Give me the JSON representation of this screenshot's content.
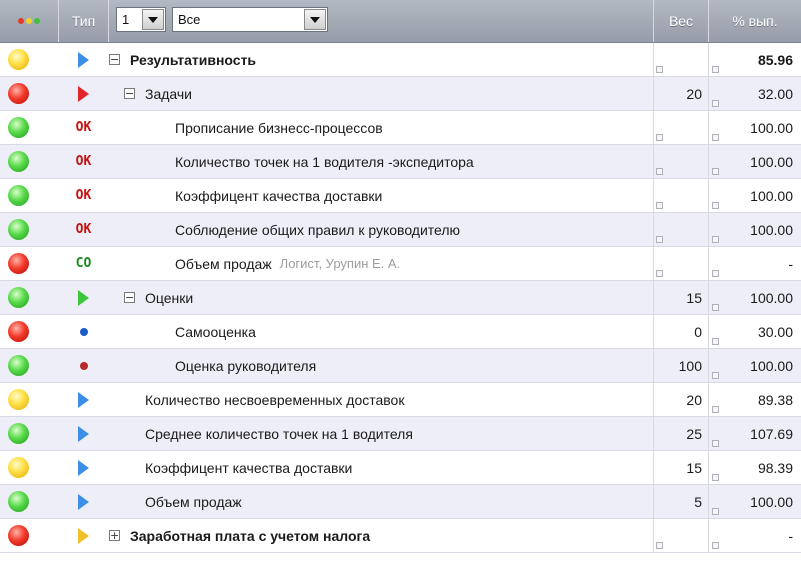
{
  "header": {
    "type_label": "Тип",
    "level_value": "1",
    "filter_value": "Все",
    "weight_label": "Вес",
    "percent_label": "% вып."
  },
  "colors": {
    "lamp_yellow": "#ffe24a",
    "lamp_red": "#f23a2a",
    "lamp_green": "#57d84a"
  },
  "rows": [
    {
      "lamp": "yellow",
      "type": "play-blue",
      "name": "Результативность",
      "expander": "minus",
      "bold": true,
      "weight": "",
      "percent": "85.96",
      "percent_bold": true
    },
    {
      "lamp": "red",
      "type": "play-red",
      "name": "Задачи",
      "expander": "minus",
      "weight": "20",
      "percent": "32.00"
    },
    {
      "lamp": "green",
      "type": "OK",
      "name": "Прописание бизнесс-процессов",
      "weight": "",
      "percent": "100.00"
    },
    {
      "lamp": "green",
      "type": "OK",
      "name": "Количество точек на 1 водителя -экспедитора",
      "weight": "",
      "percent": "100.00"
    },
    {
      "lamp": "green",
      "type": "OK",
      "name": "Коэффицент качества доставки",
      "weight": "",
      "percent": "100.00"
    },
    {
      "lamp": "green",
      "type": "OK",
      "name": "Соблюдение общих правил к руководителю",
      "weight": "",
      "percent": "100.00"
    },
    {
      "lamp": "red",
      "type": "CO",
      "name": "Объем продаж",
      "hint": "Логист, Урупин Е. А.",
      "weight": "",
      "percent": "-"
    },
    {
      "lamp": "green",
      "type": "play-green",
      "name": "Оценки",
      "expander": "minus",
      "weight": "15",
      "percent": "100.00"
    },
    {
      "lamp": "red",
      "type": "dot-blue",
      "name": "Самооценка",
      "weight": "0",
      "percent": "30.00"
    },
    {
      "lamp": "green",
      "type": "dot-red",
      "name": "Оценка руководителя",
      "weight": "100",
      "percent": "100.00"
    },
    {
      "lamp": "yellow",
      "type": "play-blue",
      "name": "Количество несвоевременных доставок",
      "weight": "20",
      "percent": "89.38"
    },
    {
      "lamp": "green",
      "type": "play-blue",
      "name": "Среднее количество точек на 1 водителя",
      "weight": "25",
      "percent": "107.69"
    },
    {
      "lamp": "yellow",
      "type": "play-blue",
      "name": "Коэффицент качества доставки",
      "weight": "15",
      "percent": "98.39"
    },
    {
      "lamp": "green",
      "type": "play-blue",
      "name": "Объем продаж",
      "weight": "5",
      "percent": "100.00"
    },
    {
      "lamp": "red",
      "type": "play-yellow",
      "name": "Заработная плата с учетом налога",
      "expander": "plus",
      "bold": true,
      "weight": "",
      "percent": "-"
    }
  ]
}
